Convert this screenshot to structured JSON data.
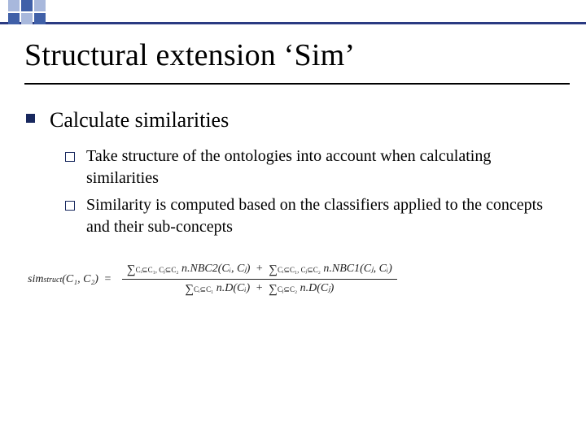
{
  "title": "Structural extension ‘Sim’",
  "bullets": {
    "main": "Calculate similarities",
    "subs": [
      "Take structure of the ontologies into account when calculating similarities",
      "Similarity is computed based on the classifiers applied to  the concepts and their sub-concepts"
    ]
  },
  "formula": {
    "lhs_name": "sim",
    "lhs_sub": "struct",
    "lhs_args": "(C₁, C₂)",
    "eq": "=",
    "num_term1_sum_sub": "Cᵢ⊆C₁, Cⱼ⊆C₂",
    "num_term1_body": "n.NBC2(Cᵢ, Cⱼ)",
    "num_plus": "+",
    "num_term2_sum_sub": "Cᵢ⊆C₁, Cⱼ⊆C₂",
    "num_term2_body": "n.NBC1(Cⱼ, Cᵢ)",
    "den_term1_sum_sub": "Cᵢ⊆C₁",
    "den_term1_body": "n.D(Cᵢ)",
    "den_plus": "+",
    "den_term2_sum_sub": "Cⱼ⊆C₂",
    "den_term2_body": "n.D(Cⱼ)"
  }
}
